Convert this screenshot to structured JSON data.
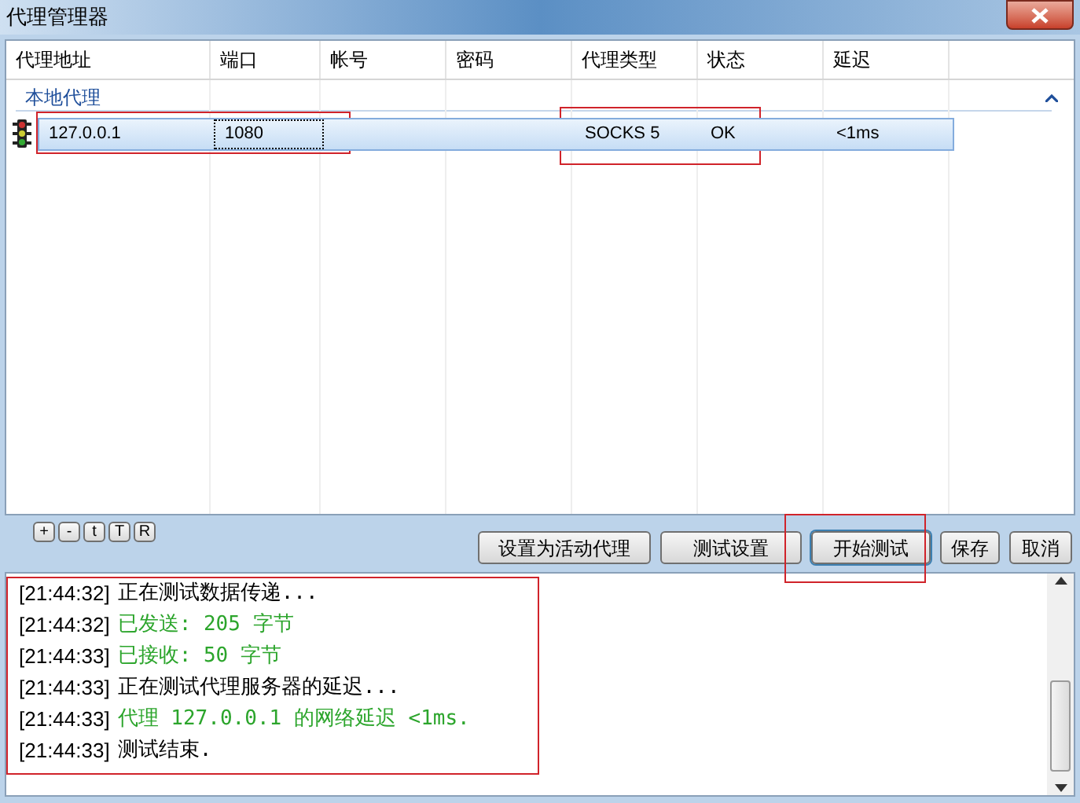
{
  "window": {
    "title": "代理管理器"
  },
  "table": {
    "columns": [
      "代理地址",
      "端口",
      "帐号",
      "密码",
      "代理类型",
      "状态",
      "延迟"
    ],
    "groups": [
      {
        "label": "本地代理",
        "expanded": true,
        "rows": [
          {
            "selected": true,
            "cells": [
              "127.0.0.1",
              "1080",
              "",
              "",
              "SOCKS 5",
              "OK",
              "<1ms"
            ]
          }
        ]
      }
    ]
  },
  "mini_buttons": [
    "+",
    "-",
    "t",
    "T",
    "R"
  ],
  "buttons": [
    "设置为活动代理",
    "测试设置",
    "开始测试",
    "保存",
    "取消"
  ],
  "log": [
    {
      "time": "[21:44:32]",
      "message": "正在测试数据传递...",
      "kind": "info"
    },
    {
      "time": "[21:44:32]",
      "message": "已发送: 205 字节",
      "kind": "success"
    },
    {
      "time": "[21:44:33]",
      "message": "已接收: 50 字节",
      "kind": "success"
    },
    {
      "time": "[21:44:33]",
      "message": "正在测试代理服务器的延迟...",
      "kind": "info"
    },
    {
      "time": "[21:44:33]",
      "message": "代理 127.0.0.1 的网络延迟 <1ms.",
      "kind": "success"
    },
    {
      "time": "[21:44:33]",
      "message": "测试结束.",
      "kind": "info"
    }
  ]
}
